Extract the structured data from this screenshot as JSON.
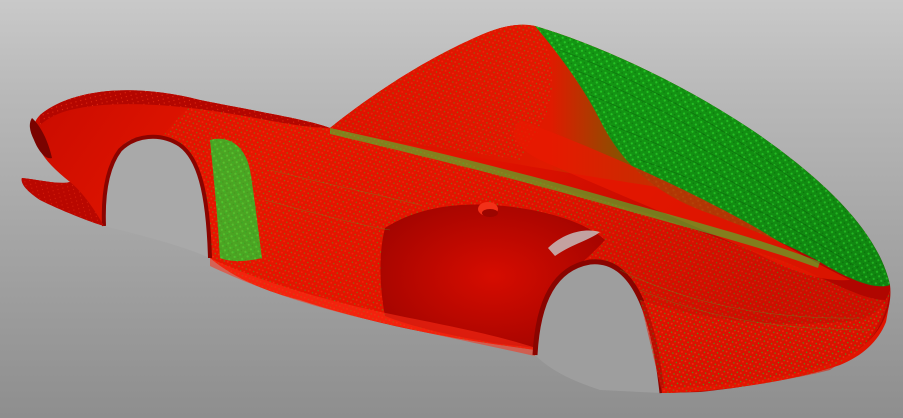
{
  "viewer": {
    "background_top": "#c9c9c9",
    "background_bottom": "#8e8e8e",
    "model": "car-body-shell-point-cloud",
    "colors": {
      "deviation_high": "#ff1400",
      "deviation_mid": "#c80000",
      "deviation_low": "#1bcf1b",
      "deviation_dark_low": "#0f8a0f"
    }
  }
}
